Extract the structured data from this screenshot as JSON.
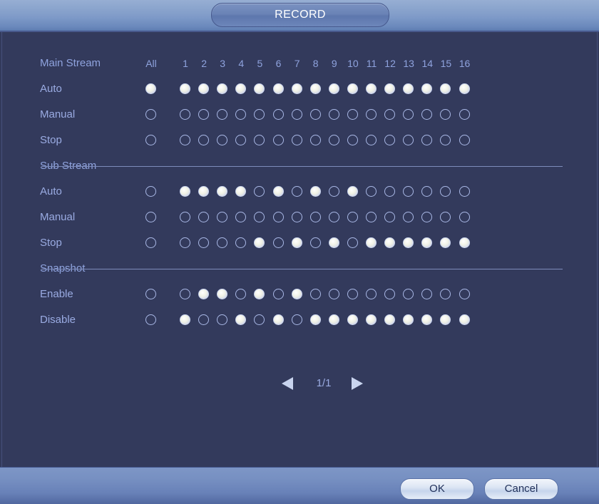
{
  "window": {
    "title": "RECORD"
  },
  "grid": {
    "all_label": "All",
    "channels": [
      "1",
      "2",
      "3",
      "4",
      "5",
      "6",
      "7",
      "8",
      "9",
      "10",
      "11",
      "12",
      "13",
      "14",
      "15",
      "16"
    ],
    "sections": [
      {
        "key": "main_stream",
        "label": "Main Stream",
        "is_header_row": true,
        "rows": [
          {
            "key": "auto",
            "label": "Auto",
            "all": 1,
            "values": [
              1,
              1,
              1,
              1,
              1,
              1,
              1,
              1,
              1,
              1,
              1,
              1,
              1,
              1,
              1,
              1
            ]
          },
          {
            "key": "manual",
            "label": "Manual",
            "all": 0,
            "values": [
              0,
              0,
              0,
              0,
              0,
              0,
              0,
              0,
              0,
              0,
              0,
              0,
              0,
              0,
              0,
              0
            ]
          },
          {
            "key": "stop",
            "label": "Stop",
            "all": 0,
            "values": [
              0,
              0,
              0,
              0,
              0,
              0,
              0,
              0,
              0,
              0,
              0,
              0,
              0,
              0,
              0,
              0
            ]
          }
        ]
      },
      {
        "key": "sub_stream",
        "label": "Sub Stream",
        "is_header_row": false,
        "rows": [
          {
            "key": "auto",
            "label": "Auto",
            "all": 0,
            "values": [
              1,
              1,
              1,
              1,
              0,
              1,
              0,
              1,
              0,
              1,
              0,
              0,
              0,
              0,
              0,
              0
            ]
          },
          {
            "key": "manual",
            "label": "Manual",
            "all": 0,
            "values": [
              0,
              0,
              0,
              0,
              0,
              0,
              0,
              0,
              0,
              0,
              0,
              0,
              0,
              0,
              0,
              0
            ]
          },
          {
            "key": "stop",
            "label": "Stop",
            "all": 0,
            "values": [
              0,
              0,
              0,
              0,
              1,
              0,
              1,
              0,
              1,
              0,
              1,
              1,
              1,
              1,
              1,
              1
            ]
          }
        ]
      },
      {
        "key": "snapshot",
        "label": "Snapshot",
        "is_header_row": false,
        "rows": [
          {
            "key": "enable",
            "label": "Enable",
            "all": 0,
            "values": [
              0,
              1,
              1,
              0,
              1,
              0,
              1,
              0,
              0,
              0,
              0,
              0,
              0,
              0,
              0,
              0
            ]
          },
          {
            "key": "disable",
            "label": "Disable",
            "all": 0,
            "values": [
              1,
              0,
              0,
              1,
              0,
              1,
              0,
              1,
              1,
              1,
              1,
              1,
              1,
              1,
              1,
              1
            ]
          }
        ]
      }
    ]
  },
  "pager": {
    "prev_icon": "triangle-left-icon",
    "next_icon": "triangle-right-icon",
    "page_label": "1/1"
  },
  "footer": {
    "ok_label": "OK",
    "cancel_label": "Cancel"
  },
  "colors": {
    "body_bg": "#333a5c",
    "accent_text": "#9aabe2",
    "titlebar": "#7e9ac8",
    "radio_on": "#f1f2e6"
  }
}
